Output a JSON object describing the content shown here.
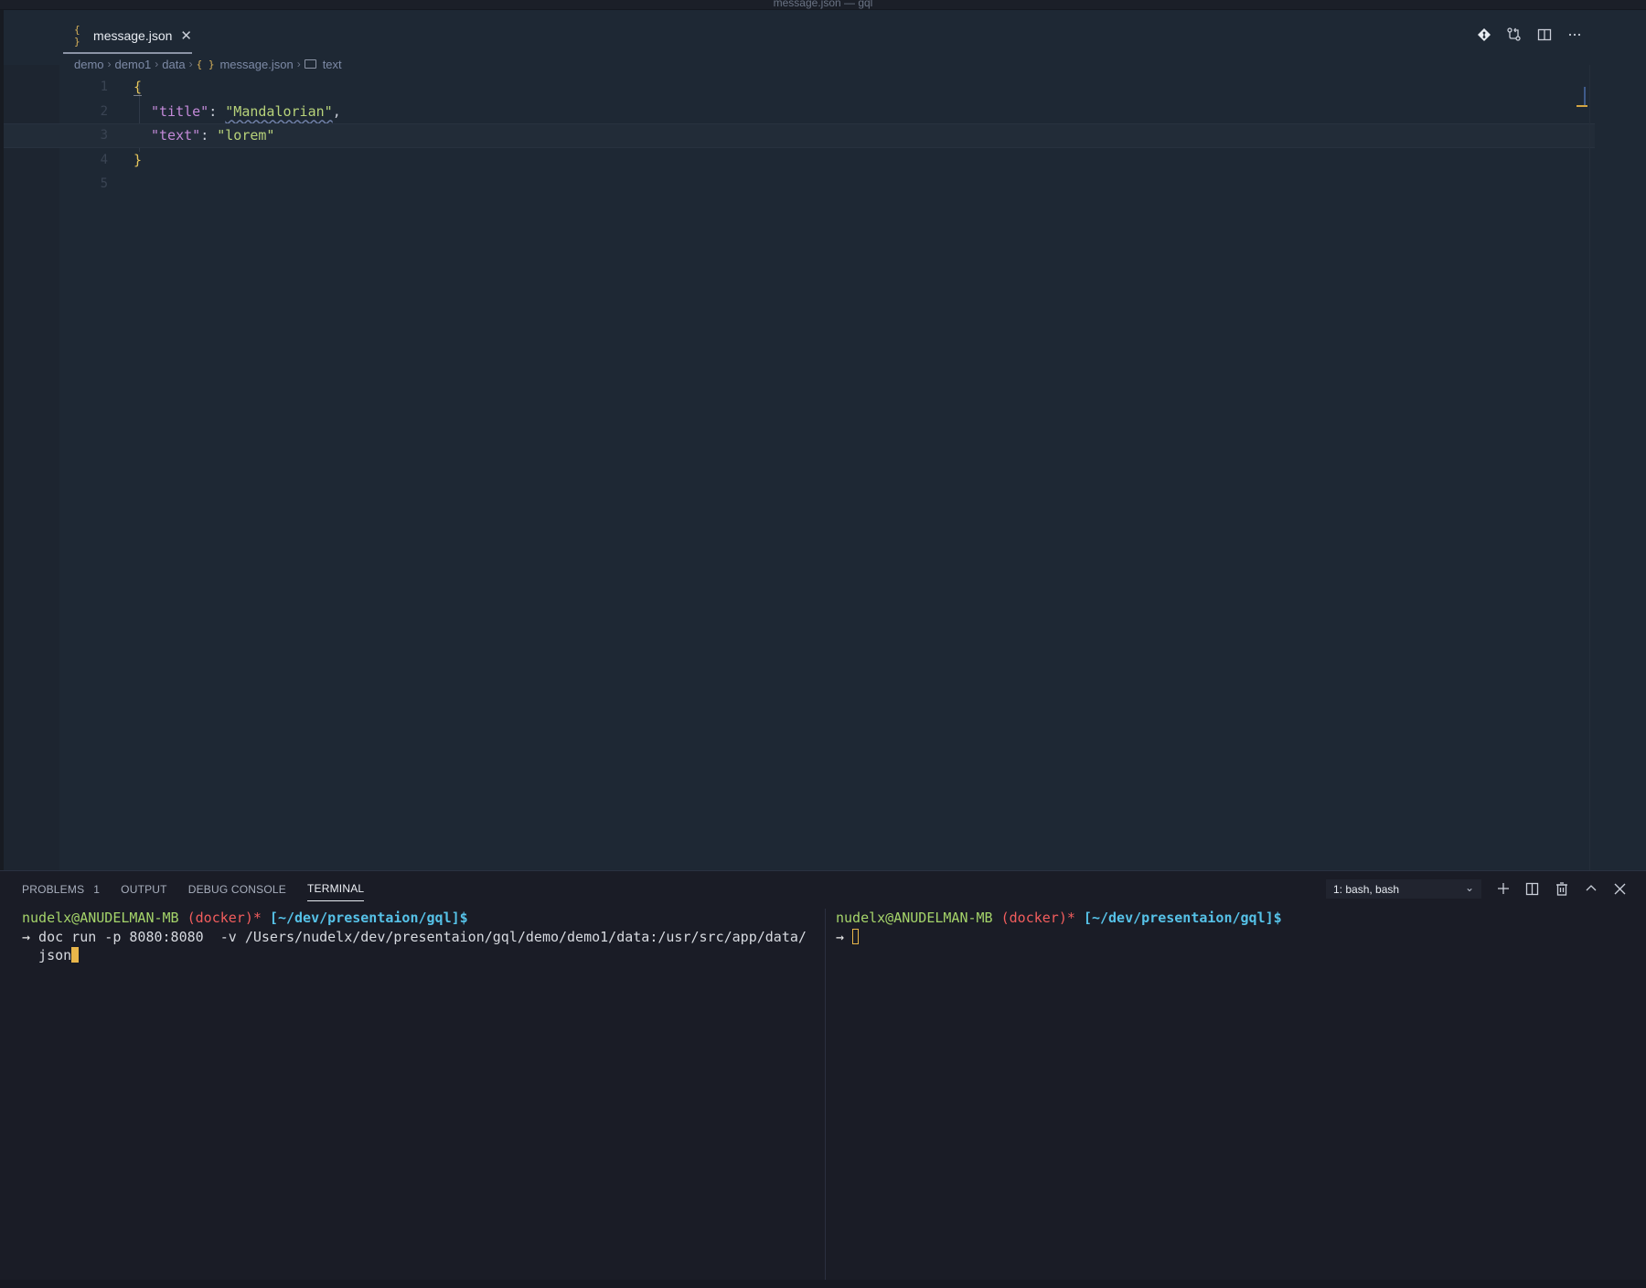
{
  "window": {
    "title": "message.json — gql"
  },
  "editor": {
    "tab": {
      "icon": "{ }",
      "label": "message.json",
      "close": "✕"
    },
    "actions": [
      "git-compare-icon",
      "source-control-icon",
      "split-editor-icon",
      "more-actions-icon"
    ],
    "breadcrumb": {
      "items": [
        "demo",
        "demo1",
        "data"
      ],
      "file_icon": "{ }",
      "file": "message.json",
      "symbol": "text"
    },
    "lines": [
      {
        "num": "1",
        "open_brace": "{"
      },
      {
        "num": "2",
        "key": "\"title\"",
        "colon": ": ",
        "value": "\"Mandalorian\"",
        "trail": ","
      },
      {
        "num": "3",
        "key": "\"text\"",
        "colon": ": ",
        "value": "\"lorem\""
      },
      {
        "num": "4",
        "close_brace": "}"
      },
      {
        "num": "5"
      }
    ]
  },
  "panel": {
    "tabs": [
      {
        "label": "PROBLEMS",
        "count": "1"
      },
      {
        "label": "OUTPUT"
      },
      {
        "label": "DEBUG CONSOLE"
      },
      {
        "label": "TERMINAL",
        "active": true
      }
    ],
    "terminal_select": "1: bash, bash",
    "actions": [
      "add-icon",
      "split-icon",
      "trash-icon",
      "maximize-icon",
      "close-icon"
    ],
    "terminals": [
      {
        "user": "nudelx@ANUDELMAN-MB",
        "git": " (docker)*",
        "path": " [~/dev/presentaion/gql]$",
        "arrow": "→",
        "command_line1": " doc run -p 8080:8080  -v /Users/nudelx/dev/presentaion/gql/demo/demo1/data:/usr/src/app/data/",
        "command_line2": "  json"
      },
      {
        "user": "nudelx@ANUDELMAN-MB",
        "git": " (docker)*",
        "path": " [~/dev/presentaion/gql]$",
        "arrow": "→"
      }
    ]
  },
  "colors": {
    "accent_yellow": "#e9b64a",
    "terminal_user": "#a5d46a",
    "terminal_git": "#f25d5d",
    "terminal_path": "#56c2e8",
    "json_key": "#c38ad8",
    "json_string": "#b7d27a"
  }
}
